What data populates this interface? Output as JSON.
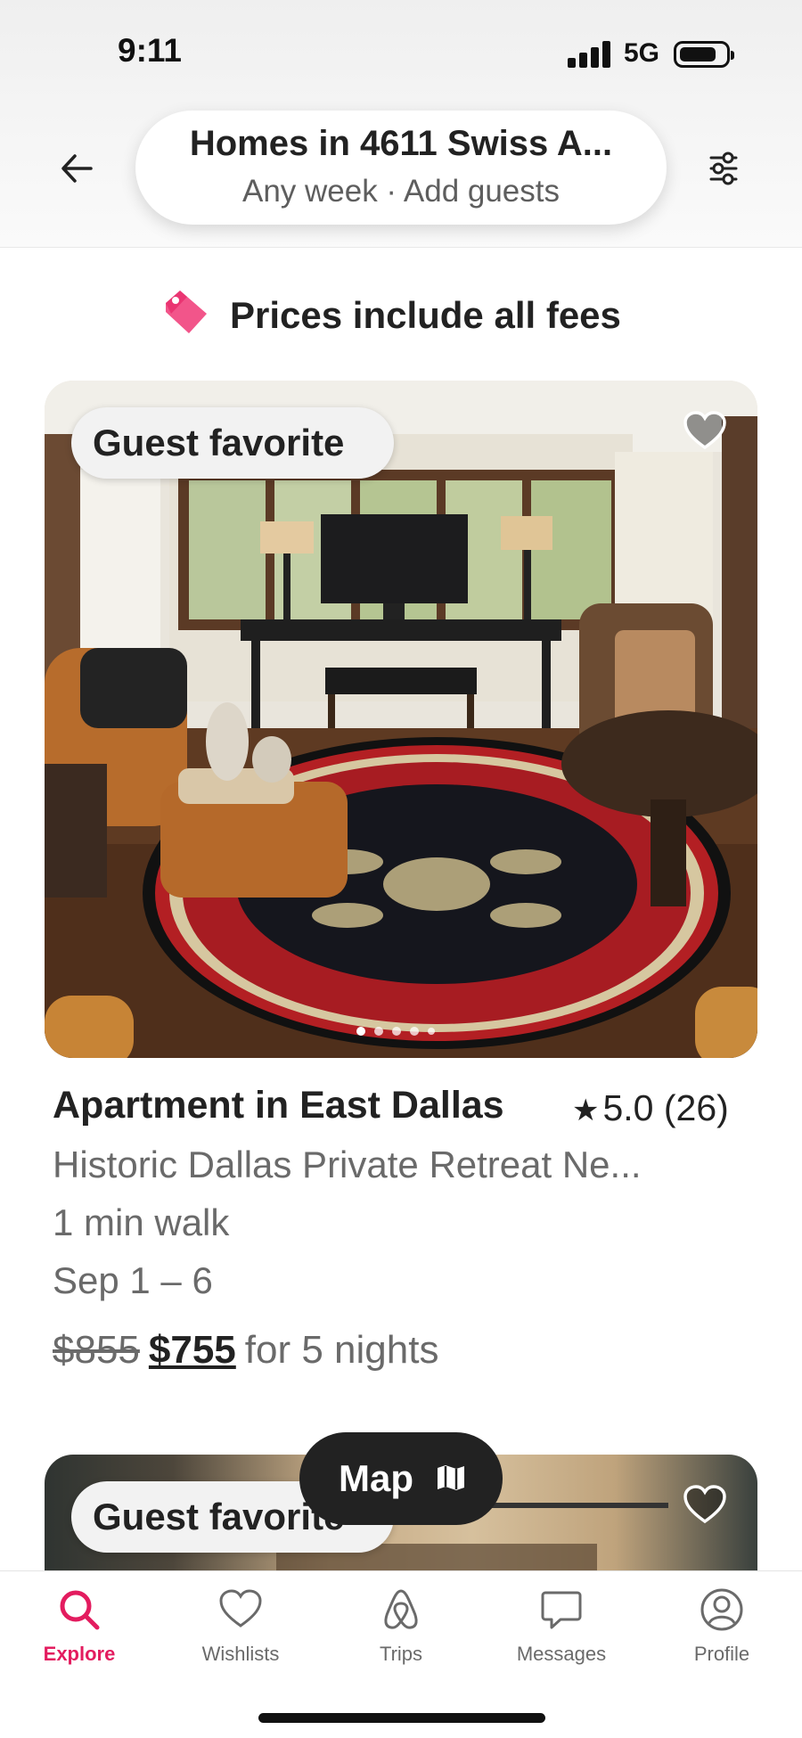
{
  "status_bar": {
    "time": "9:11",
    "network": "5G"
  },
  "search": {
    "title": "Homes in 4611 Swiss A...",
    "subtitle": "Any week · Add guests"
  },
  "notice": {
    "text": "Prices include all fees"
  },
  "listing": {
    "badge": "Guest favorite",
    "title": "Apartment in East Dallas",
    "rating": "5.0 (26)",
    "description": "Historic Dallas Private Retreat Ne...",
    "distance": "1 min walk",
    "dates": "Sep 1 – 6",
    "price_original": "$855",
    "price_current": "$755",
    "price_suffix": "for 5 nights",
    "photo_count": 5
  },
  "listing2": {
    "badge": "Guest favorite"
  },
  "map_button": {
    "label": "Map"
  },
  "tabs": [
    {
      "label": "Explore",
      "icon": "search-icon",
      "active": true
    },
    {
      "label": "Wishlists",
      "icon": "heart-icon",
      "active": false
    },
    {
      "label": "Trips",
      "icon": "airbnb-logo-icon",
      "active": false
    },
    {
      "label": "Messages",
      "icon": "message-icon",
      "active": false
    },
    {
      "label": "Profile",
      "icon": "profile-icon",
      "active": false
    }
  ],
  "colors": {
    "accent": "#e31c5f",
    "text": "#222222",
    "muted": "#6a6a6a"
  }
}
